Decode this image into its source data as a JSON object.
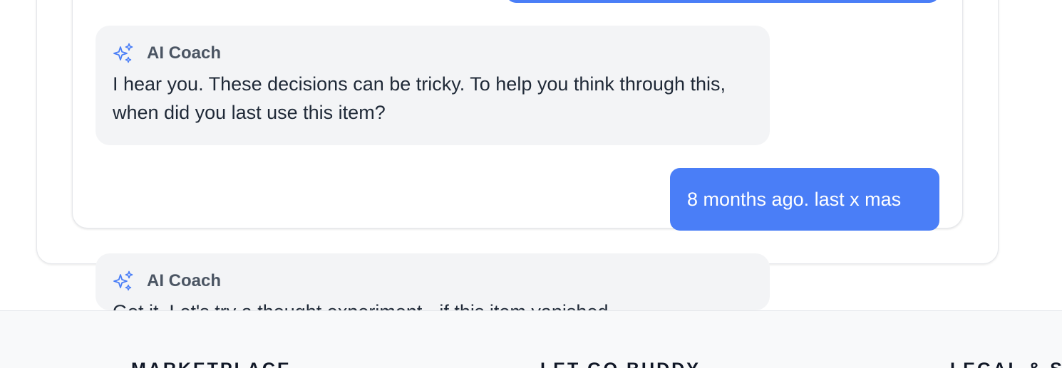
{
  "colors": {
    "accent": "#4a7ef7",
    "ai_bubble_bg": "#f3f4f6",
    "footer_bg": "#f8f9fa"
  },
  "chat": {
    "messages": [
      {
        "role": "ai",
        "sender": "AI Coach",
        "icon": "sparkles-icon",
        "text": "I hear you. These decisions can be tricky. To help you think through this, when did you last use this item?"
      },
      {
        "role": "user",
        "text": "8 months ago. last x mas"
      },
      {
        "role": "ai",
        "sender": "AI Coach",
        "icon": "sparkles-icon",
        "text": "Got it. Let's try a thought experiment - if this item vanished"
      }
    ]
  },
  "footer": {
    "columns": [
      {
        "heading": "MARKETPLACE"
      },
      {
        "heading": "LET GO BUDDY"
      },
      {
        "heading": "LEGAL & SUPPORT"
      }
    ]
  }
}
